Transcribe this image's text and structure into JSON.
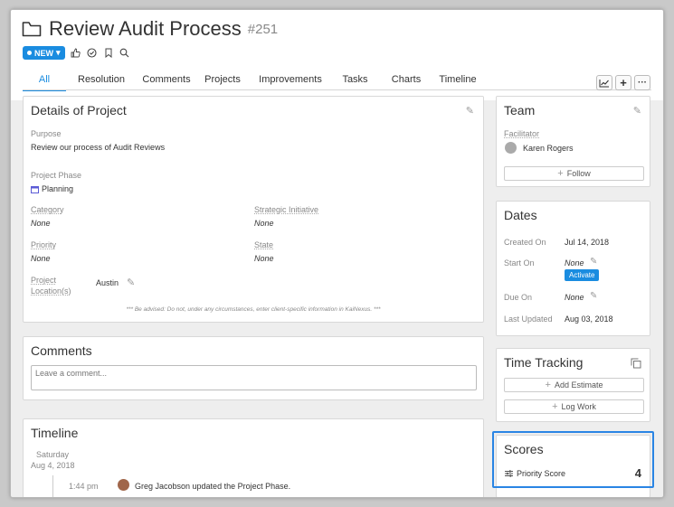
{
  "header": {
    "title": "Review Audit Process",
    "number": "#251",
    "status_label": "NEW"
  },
  "tabs": [
    "All",
    "Resolution",
    "Comments",
    "Projects",
    "Improvements",
    "Tasks",
    "Charts",
    "Timeline"
  ],
  "details": {
    "heading": "Details of Project",
    "purpose_label": "Purpose",
    "purpose_value": "Review our process of Audit Reviews",
    "phase_label": "Project Phase",
    "phase_value": "Planning",
    "category_label": "Category",
    "category_value": "None",
    "initiative_label": "Strategic Initiative",
    "initiative_value": "None",
    "priority_label": "Priority",
    "priority_value": "None",
    "state_label": "State",
    "state_value": "None",
    "location_label_1": "Project",
    "location_label_2": "Location(s)",
    "location_value": "Austin",
    "advisory": "*** Be advised: Do not, under any circumstances, enter client-specific information in KaiNexus. ***"
  },
  "comments": {
    "heading": "Comments",
    "placeholder": "Leave a comment..."
  },
  "timeline": {
    "heading": "Timeline",
    "day": "Saturday",
    "date": "Aug 4, 2018",
    "time": "1:44 pm",
    "entry": "Greg Jacobson updated the Project Phase."
  },
  "team": {
    "heading": "Team",
    "facilitator_label": "Facilitator",
    "facilitator_name": "Karen Rogers",
    "follow_label": "Follow"
  },
  "dates": {
    "heading": "Dates",
    "created_label": "Created On",
    "created_value": "Jul 14, 2018",
    "start_label": "Start On",
    "start_value": "None",
    "activate_label": "Activate",
    "due_label": "Due On",
    "due_value": "None",
    "updated_label": "Last Updated",
    "updated_value": "Aug 03, 2018"
  },
  "time_tracking": {
    "heading": "Time Tracking",
    "estimate_label": "Add Estimate",
    "logwork_label": "Log Work"
  },
  "scores": {
    "heading": "Scores",
    "priority_label": "Priority Score",
    "priority_value": "4"
  },
  "colors": {
    "accent": "#1a8ce0",
    "highlight": "#2a85e4"
  }
}
